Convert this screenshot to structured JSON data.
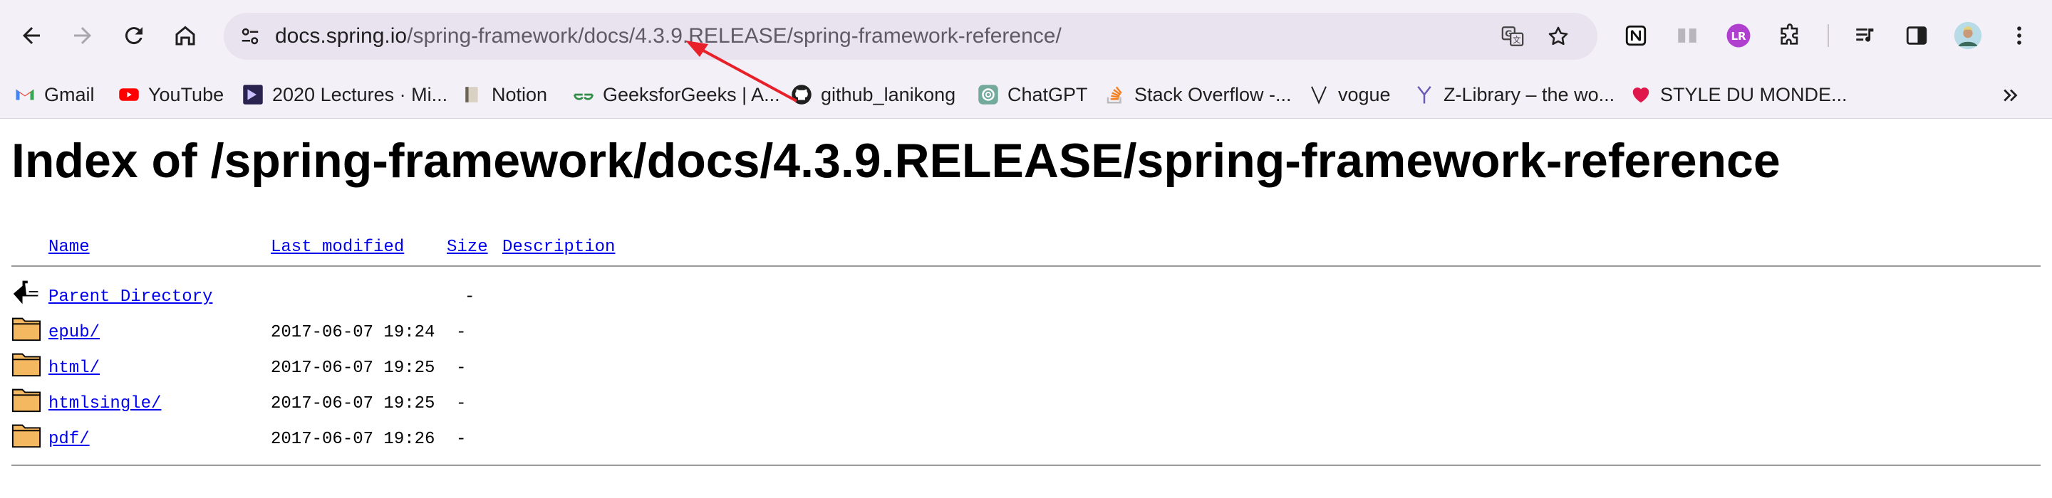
{
  "browser": {
    "url_host": "docs.spring.io",
    "url_path": "/spring-framework/docs/4.3.9.RELEASE/spring-framework-reference/",
    "bookmarks": [
      {
        "label": "Gmail",
        "icon": "gmail-icon"
      },
      {
        "label": "YouTube",
        "icon": "youtube-icon"
      },
      {
        "label": "2020 Lectures · Mi...",
        "icon": "lecture-icon"
      },
      {
        "label": "Notion",
        "icon": "notion-icon"
      },
      {
        "label": "GeeksforGeeks | A...",
        "icon": "geeksforgeeks-icon"
      },
      {
        "label": "github_lanikong",
        "icon": "github-icon"
      },
      {
        "label": "ChatGPT",
        "icon": "chatgpt-icon"
      },
      {
        "label": "Stack Overflow -...",
        "icon": "stackoverflow-icon"
      },
      {
        "label": "vogue",
        "icon": "vogue-icon"
      },
      {
        "label": "Z-Library – the wo...",
        "icon": "zlibrary-icon"
      },
      {
        "label": "STYLE DU MONDE...",
        "icon": "heart-icon"
      }
    ],
    "extensions": [
      {
        "name": "notion-web-clipper-icon"
      },
      {
        "name": "reading-mode-icon"
      },
      {
        "name": "language-reactor-icon",
        "label": "LR"
      },
      {
        "name": "extensions-puzzle-icon"
      },
      {
        "name": "media-controls-icon"
      },
      {
        "name": "side-panel-icon"
      },
      {
        "name": "profile-avatar-icon"
      }
    ]
  },
  "page": {
    "title": "Index of /spring-framework/docs/4.3.9.RELEASE/spring-framework-reference",
    "columns": {
      "name": "Name",
      "last_modified": "Last modified",
      "size": "Size",
      "description": "Description"
    },
    "parent": {
      "name": "Parent Directory",
      "size": "-",
      "icon": "back-arrow-icon"
    },
    "entries": [
      {
        "name": "epub/",
        "modified": "2017-06-07 19:24",
        "size": "-",
        "icon": "folder-icon"
      },
      {
        "name": "html/",
        "modified": "2017-06-07 19:25",
        "size": "-",
        "icon": "folder-icon"
      },
      {
        "name": "htmlsingle/",
        "modified": "2017-06-07 19:25",
        "size": "-",
        "icon": "folder-icon"
      },
      {
        "name": "pdf/",
        "modified": "2017-06-07 19:26",
        "size": "-",
        "icon": "folder-icon"
      }
    ]
  },
  "colors": {
    "toolbar_bg": "#f3f0f7",
    "omnibox_bg": "#e8e3ef",
    "link": "#0000ee",
    "annotation_arrow": "#e8202a",
    "folder": "#f4b860"
  }
}
